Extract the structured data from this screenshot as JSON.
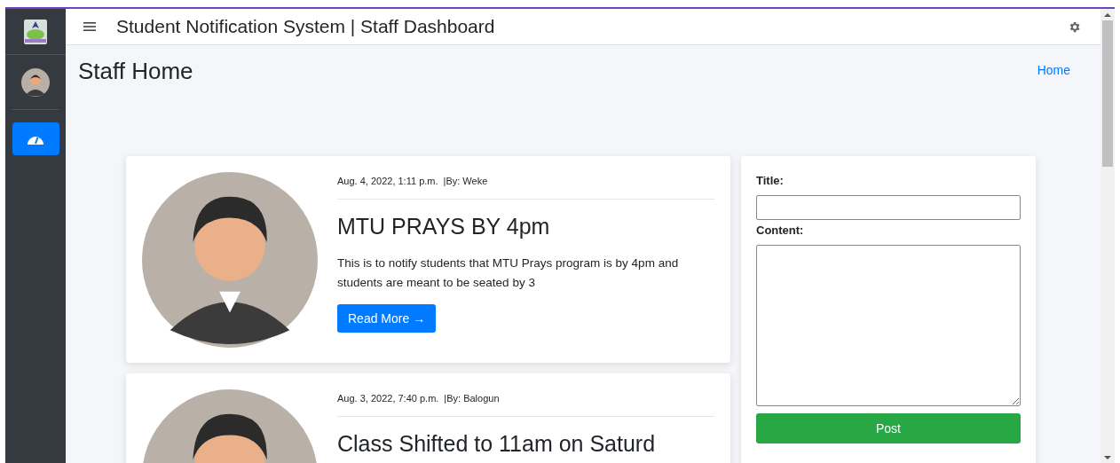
{
  "header": {
    "title": "Student Notification System | Staff Dashboard"
  },
  "sidebar": {
    "items": [
      {
        "kind": "dashboard",
        "selected": true
      }
    ]
  },
  "page": {
    "title": "Staff Home",
    "breadcrumb": "Home"
  },
  "posts": [
    {
      "date": "Aug. 4, 2022, 1:11 p.m.",
      "author": "|By: Weke",
      "title": "MTU PRAYS BY 4pm",
      "body": "This is to notify students that MTU Prays program is by 4pm and students are meant to be seated by 3",
      "button": "Read More →"
    },
    {
      "date": "Aug. 3, 2022, 7:40 p.m.",
      "author": "|By: Balogun",
      "title": "Class Shifted to 11am on Saturd"
    }
  ],
  "form": {
    "title_label": "Title:",
    "content_label": "Content:",
    "button": "Post"
  }
}
